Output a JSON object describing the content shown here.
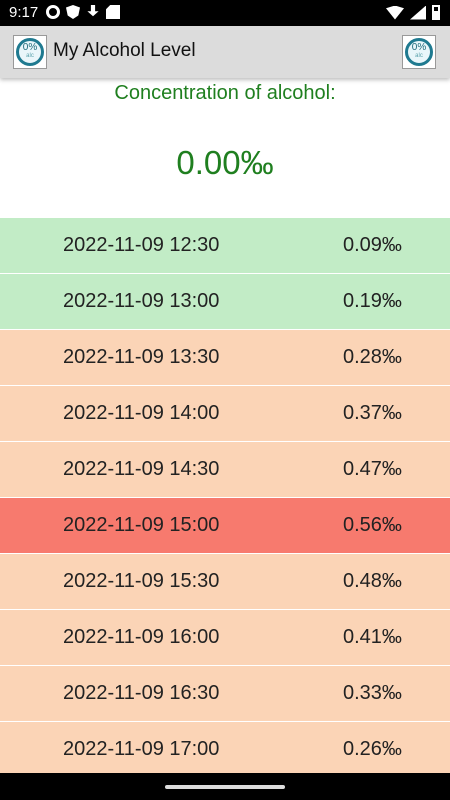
{
  "status_bar": {
    "time": "9:17",
    "left_icons": [
      "gear-icon",
      "shield-icon",
      "download-icon",
      "sd-card-icon"
    ],
    "right_icons": [
      "wifi-icon",
      "signal-icon",
      "battery-icon"
    ]
  },
  "app_bar": {
    "title": "My Alcohol Level",
    "logo_text_main": "0%",
    "logo_text_sub": "alc"
  },
  "header": {
    "concentration_label": "Concentration of alcohol:",
    "concentration_value": "0.00‰",
    "text_color": "#1f7f1f"
  },
  "colors": {
    "green": "#c2ecc6",
    "orange": "#fbd4b6",
    "red": "#f77a6e"
  },
  "readings": [
    {
      "time": "2022-11-09 12:30",
      "value": "0.09‰",
      "status": "green"
    },
    {
      "time": "2022-11-09 13:00",
      "value": "0.19‰",
      "status": "green"
    },
    {
      "time": "2022-11-09 13:30",
      "value": "0.28‰",
      "status": "orange"
    },
    {
      "time": "2022-11-09 14:00",
      "value": "0.37‰",
      "status": "orange"
    },
    {
      "time": "2022-11-09 14:30",
      "value": "0.47‰",
      "status": "orange"
    },
    {
      "time": "2022-11-09 15:00",
      "value": "0.56‰",
      "status": "red"
    },
    {
      "time": "2022-11-09 15:30",
      "value": "0.48‰",
      "status": "orange"
    },
    {
      "time": "2022-11-09 16:00",
      "value": "0.41‰",
      "status": "orange"
    },
    {
      "time": "2022-11-09 16:30",
      "value": "0.33‰",
      "status": "orange"
    },
    {
      "time": "2022-11-09 17:00",
      "value": "0.26‰",
      "status": "orange"
    }
  ]
}
